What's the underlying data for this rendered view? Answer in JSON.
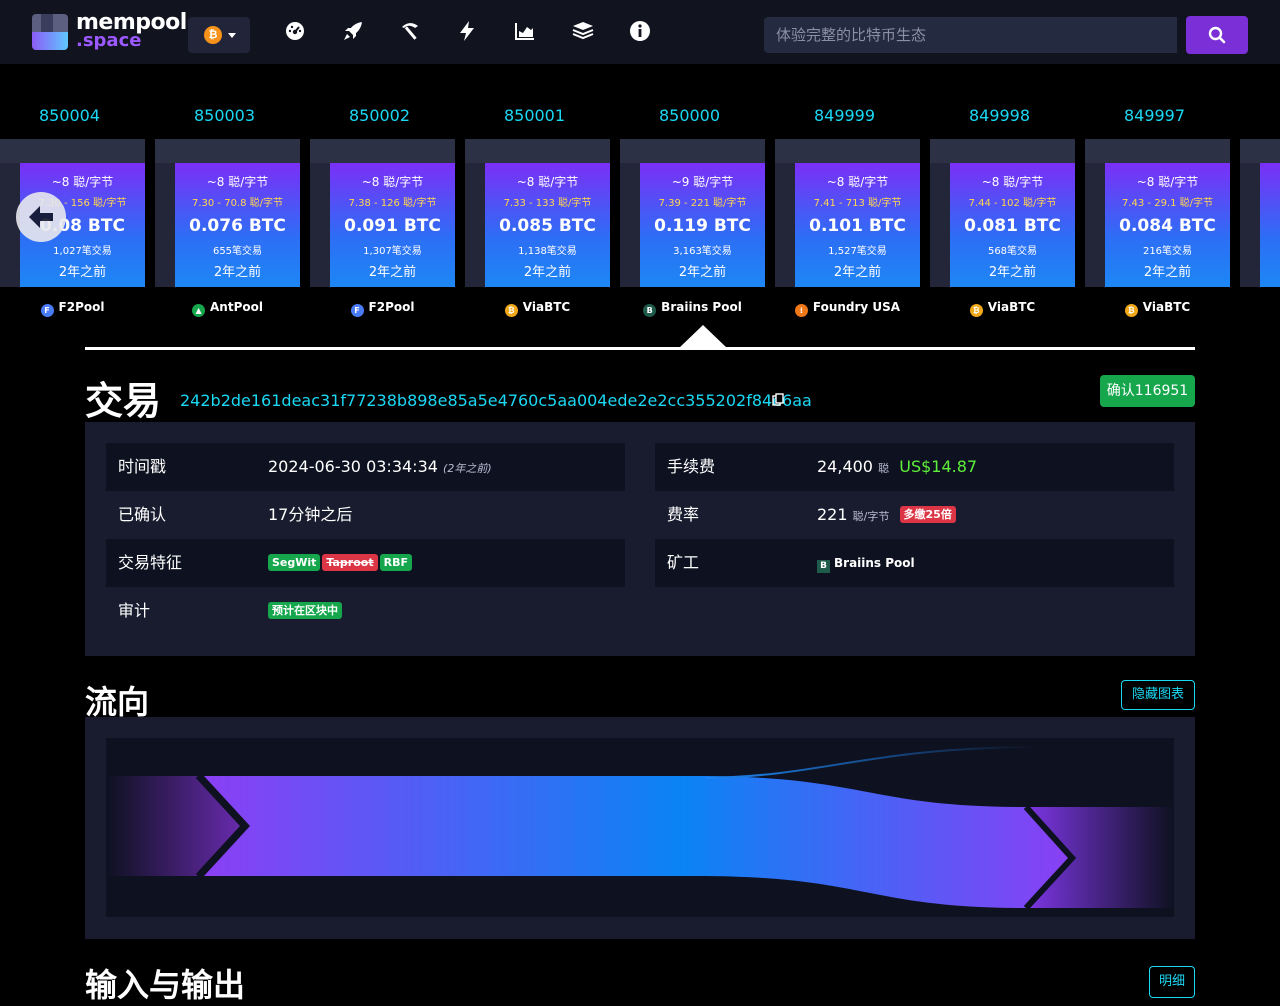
{
  "header": {
    "logo_line1": "mempool",
    "logo_line2": ".space",
    "network_symbol": "₿",
    "search_placeholder": "体验完整的比特币生态",
    "nav_icons": [
      "dashboard-icon",
      "rocket-icon",
      "mining-icon",
      "lightning-icon",
      "graphs-icon",
      "docs-icon",
      "about-icon"
    ]
  },
  "blocks": [
    {
      "height": "850004",
      "median_fee": "~8 聪/字节",
      "fee_range": "7.30 - 156 聪/字节",
      "total": "0.08 BTC",
      "tx_count": "1,027笔交易",
      "age": "2年之前",
      "pool": "F2Pool",
      "pool_color": "#4a7bf7",
      "pool_glyph": "F"
    },
    {
      "height": "850003",
      "median_fee": "~8 聪/字节",
      "fee_range": "7.30 - 70.8 聪/字节",
      "total": "0.076 BTC",
      "tx_count": "655笔交易",
      "age": "2年之前",
      "pool": "AntPool",
      "pool_color": "#16a74d",
      "pool_glyph": "▲"
    },
    {
      "height": "850002",
      "median_fee": "~8 聪/字节",
      "fee_range": "7.38 - 126 聪/字节",
      "total": "0.091 BTC",
      "tx_count": "1,307笔交易",
      "age": "2年之前",
      "pool": "F2Pool",
      "pool_color": "#4a7bf7",
      "pool_glyph": "F"
    },
    {
      "height": "850001",
      "median_fee": "~8 聪/字节",
      "fee_range": "7.33 - 133 聪/字节",
      "total": "0.085 BTC",
      "tx_count": "1,138笔交易",
      "age": "2年之前",
      "pool": "ViaBTC",
      "pool_color": "#f0a818",
      "pool_glyph": "₿"
    },
    {
      "height": "850000",
      "median_fee": "~9 聪/字节",
      "fee_range": "7.39 - 221 聪/字节",
      "total": "0.119 BTC",
      "tx_count": "3,163笔交易",
      "age": "2年之前",
      "pool": "Braiins Pool",
      "pool_color": "#1e5b4a",
      "pool_glyph": "B"
    },
    {
      "height": "849999",
      "median_fee": "~8 聪/字节",
      "fee_range": "7.41 - 713 聪/字节",
      "total": "0.101 BTC",
      "tx_count": "1,527笔交易",
      "age": "2年之前",
      "pool": "Foundry USA",
      "pool_color": "#f07818",
      "pool_glyph": "⁞"
    },
    {
      "height": "849998",
      "median_fee": "~8 聪/字节",
      "fee_range": "7.44 - 102 聪/字节",
      "total": "0.081 BTC",
      "tx_count": "568笔交易",
      "age": "2年之前",
      "pool": "ViaBTC",
      "pool_color": "#f0a818",
      "pool_glyph": "₿"
    },
    {
      "height": "849997",
      "median_fee": "~8 聪/字节",
      "fee_range": "7.43 - 29.1 聪/字节",
      "total": "0.084 BTC",
      "tx_count": "216笔交易",
      "age": "2年之前",
      "pool": "ViaBTC",
      "pool_color": "#f0a818",
      "pool_glyph": "₿"
    }
  ],
  "tx": {
    "heading": "交易",
    "txid": "242b2de161deac31f77238b898e85a5e4760c5aa004ede2e2cc355202f84e6aa",
    "confirmations": "确认116951",
    "timestamp_label": "时间戳",
    "timestamp_value": "2024-06-30 03:34:34",
    "timestamp_ago": "(2年之前)",
    "confirmed_label": "已确认",
    "confirmed_value": "17分钟之后",
    "features_label": "交易特征",
    "features": {
      "segwit": "SegWit",
      "taproot": "Taproot",
      "rbf": "RBF"
    },
    "audit_label": "审计",
    "audit_value": "预计在区块中",
    "fee_label": "手续费",
    "fee_value": "24,400",
    "fee_unit": "聪",
    "fee_usd": "US$14.87",
    "feerate_label": "费率",
    "feerate_value": "221",
    "feerate_unit": "聪/字节",
    "overpaid": "多缴25倍",
    "miner_label": "矿工",
    "miner_value": "Braiins Pool"
  },
  "flow": {
    "heading": "流向",
    "hide_button": "隐藏图表"
  },
  "io": {
    "heading": "输入与输出",
    "details_button": "明细"
  },
  "colors": {
    "accent": "#1bd8f4",
    "purple": "#7b2fd6",
    "confirmed_green": "#16a74d",
    "usd_green": "#5ef03a",
    "danger": "#dc3545"
  }
}
